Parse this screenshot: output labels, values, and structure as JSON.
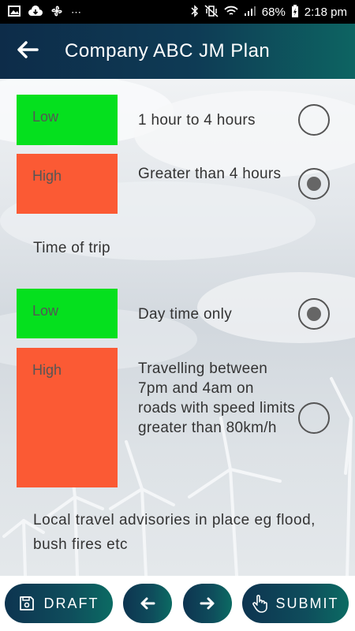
{
  "status_bar": {
    "battery": "68%",
    "time": "2:18 pm"
  },
  "header": {
    "title": "Company ABC JM Plan"
  },
  "duration_options": [
    {
      "level": "Low",
      "level_color": "#05e01e",
      "description": "1 hour to 4 hours",
      "selected": false
    },
    {
      "level": "High",
      "level_color": "#fb5a34",
      "description": "Greater than 4 hours",
      "selected": true
    }
  ],
  "time_of_trip": {
    "label": "Time of trip",
    "options": [
      {
        "level": "Low",
        "level_color": "#05e01e",
        "description": "Day time only",
        "selected": true
      },
      {
        "level": "High",
        "level_color": "#fb5a34",
        "description": "Travelling between 7pm and 4am on roads with speed limits greater than 80km/h",
        "selected": false
      }
    ]
  },
  "advisory": {
    "label": "Local travel advisories in place eg flood, bush fires etc"
  },
  "toolbar": {
    "draft_label": "DRAFT",
    "submit_label": "SUBMIT"
  }
}
